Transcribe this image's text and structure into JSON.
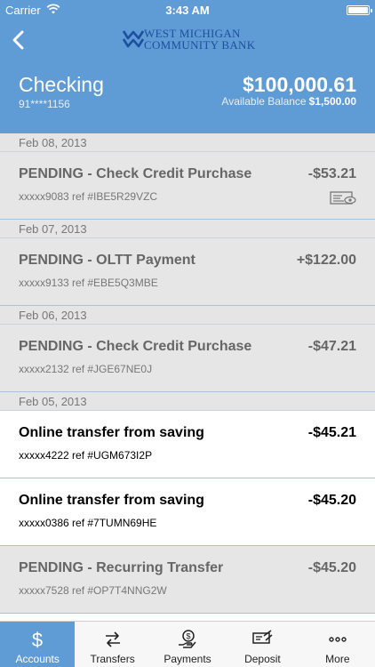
{
  "status_bar": {
    "carrier": "Carrier",
    "time": "3:43 AM"
  },
  "nav": {
    "logo_line1": "WEST MICHIGAN",
    "logo_line2": "COMMUNITY BANK",
    "back_icon": "chevron-left-icon"
  },
  "account": {
    "name": "Checking",
    "number": "91****1156",
    "balance": "$100,000.61",
    "available_label": "Available Balance",
    "available_value": "$1,500.00"
  },
  "groups": [
    {
      "date": "Feb 08, 2013",
      "transactions": [
        {
          "description": "PENDING - Check Credit Purchase",
          "ref": "xxxxx9083 ref #IBE5R29VZC",
          "amount": "-$53.21",
          "status": "pending",
          "icon": "check-image-icon"
        }
      ]
    },
    {
      "date": "Feb 07, 2013",
      "transactions": [
        {
          "description": "PENDING - OLTT Payment",
          "ref": "xxxxx9133 ref #EBE5Q3MBE",
          "amount": "+$122.00",
          "status": "pending"
        }
      ]
    },
    {
      "date": "Feb 06, 2013",
      "transactions": [
        {
          "description": "PENDING - Check Credit Purchase",
          "ref": "xxxxx2132 ref #JGE67NE0J",
          "amount": "-$47.21",
          "status": "pending"
        }
      ]
    },
    {
      "date": "Feb 05, 2013",
      "transactions": [
        {
          "description": "Online transfer from saving",
          "ref": "xxxxx4222 ref #UGM673I2P",
          "amount": "-$45.21",
          "status": "posted"
        },
        {
          "description": "Online transfer from saving",
          "ref": "xxxxx0386 ref #7TUMN69HE",
          "amount": "-$45.20",
          "status": "posted"
        },
        {
          "description": "PENDING - Recurring Transfer",
          "ref": "xxxxx7528 ref #OP7T4NNG2W",
          "amount": "-$45.20",
          "status": "pending"
        }
      ]
    }
  ],
  "tabs": [
    {
      "label": "Accounts",
      "icon": "dollar-icon",
      "active": true
    },
    {
      "label": "Transfers",
      "icon": "transfer-arrows-icon",
      "active": false
    },
    {
      "label": "Payments",
      "icon": "hand-coin-icon",
      "active": false
    },
    {
      "label": "Deposit",
      "icon": "check-deposit-icon",
      "active": false
    },
    {
      "label": "More",
      "icon": "ellipsis-icon",
      "active": false
    }
  ],
  "colors": {
    "brand_blue": "#5f9bd5",
    "logo_blue": "#1f4fa0",
    "pending_bg": "#e6e6e6"
  }
}
